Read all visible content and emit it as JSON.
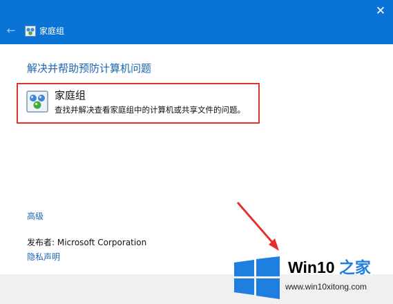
{
  "window": {
    "title": "家庭组",
    "close_glyph": "✕",
    "back_glyph": "←"
  },
  "main": {
    "heading": "解决并帮助预防计算机问题",
    "item": {
      "title": "家庭组",
      "description": "查找并解决查看家庭组中的计算机或共享文件的问题。",
      "icon": "homegroup-icon"
    },
    "advanced_link": "高级",
    "publisher": "发布者:  Microsoft Corporation",
    "privacy_link": "隐私声明"
  },
  "watermark": {
    "brand_main": "Win10",
    "brand_accent": " 之家",
    "url": "www.win10xitong.com"
  },
  "colors": {
    "titlebar": "#0a73d6",
    "link": "#1b64b0",
    "highlight_border": "#e4302c",
    "watermark_blue": "#1e7fe0"
  }
}
